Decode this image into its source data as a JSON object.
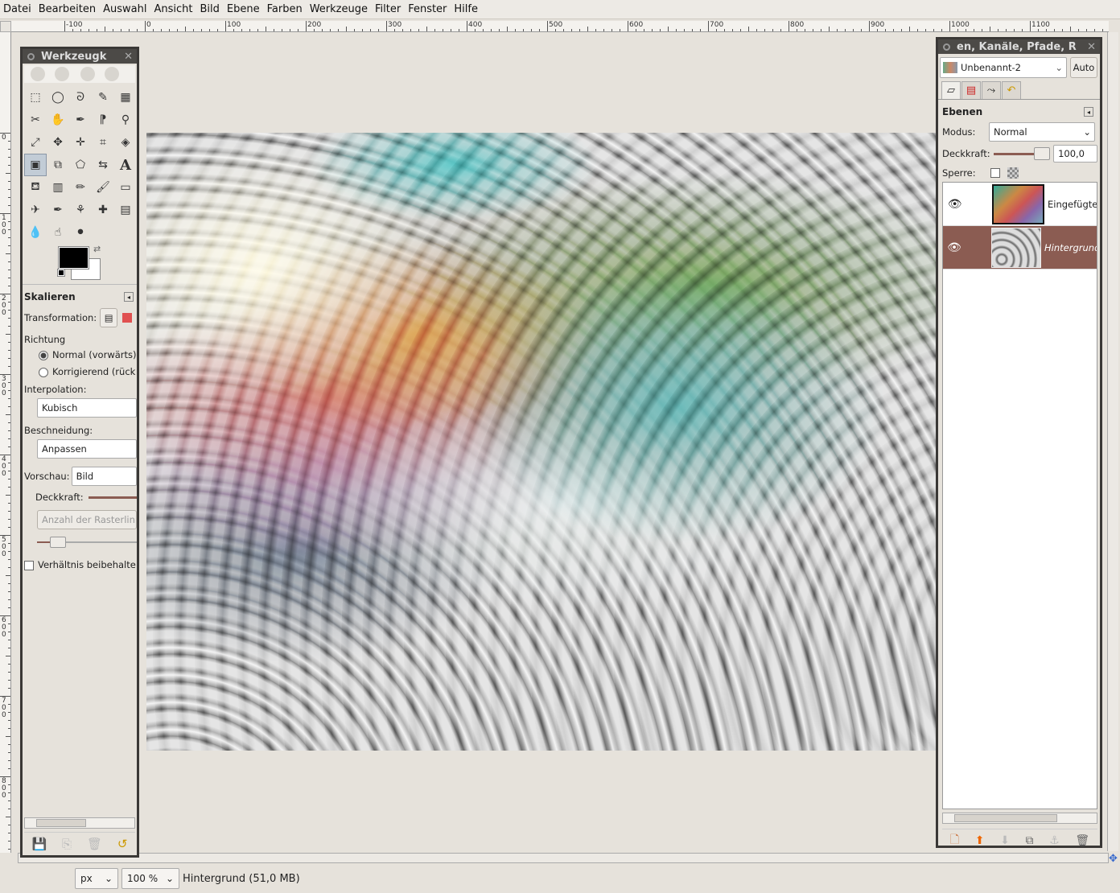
{
  "menu": [
    "Datei",
    "Bearbeiten",
    "Auswahl",
    "Ansicht",
    "Bild",
    "Ebene",
    "Farben",
    "Werkzeuge",
    "Filter",
    "Fenster",
    "Hilfe"
  ],
  "ruler": {
    "h_labels": [
      "-100",
      "0",
      "100",
      "200",
      "300",
      "400",
      "500",
      "600",
      "700",
      "800",
      "900",
      "1000",
      "1100"
    ],
    "v_labels": [
      "0",
      "100",
      "200",
      "300",
      "400",
      "500",
      "600",
      "700",
      "800"
    ]
  },
  "toolbox": {
    "title": "Werkzeugk",
    "tool_icons": [
      "rect-select-icon",
      "ellipse-select-icon",
      "lasso-icon",
      "fuzzy-select-icon",
      "select-by-color-icon",
      "scissors-icon",
      "foreground-select-icon",
      "paths-icon",
      "color-picker-icon",
      "zoom-icon",
      "measure-icon",
      "move-icon",
      "align-icon",
      "crop-icon",
      "rotate-icon",
      "scale-icon",
      "shear-icon",
      "perspective-icon",
      "flip-icon",
      "text-icon",
      "bucket-fill-icon",
      "blend-icon",
      "pencil-icon",
      "paintbrush-icon",
      "eraser-icon",
      "airbrush-icon",
      "ink-icon",
      "clone-icon",
      "heal-icon",
      "perspective-clone-icon",
      "blur-icon",
      "smudge-icon",
      "dodge-burn-icon"
    ],
    "tool_glyphs": [
      "⬚",
      "◯",
      "ᘐ",
      "✎",
      "▦",
      "✂",
      "✋",
      "✒",
      "⁋",
      "⚲",
      "⤢",
      "✥",
      "✛",
      "⌗",
      "◈",
      "▣",
      "⧉",
      "⬠",
      "⇆",
      "A",
      "⛾",
      "▥",
      "✏",
      "🖌",
      "▭",
      "✈",
      "✒",
      "⚘",
      "✚",
      "▤",
      "💧",
      "☝",
      "⚫"
    ],
    "options": {
      "title": "Skalieren",
      "transformation_label": "Transformation:",
      "direction_label": "Richtung",
      "direction_normal": "Normal (vorwärts)",
      "direction_corrective": "Korrigierend (rück",
      "interpolation_label": "Interpolation:",
      "interpolation_value": "Kubisch",
      "clipping_label": "Beschneidung:",
      "clipping_value": "Anpassen",
      "preview_label": "Vorschau:",
      "preview_value": "Bild",
      "opacity_label": "Deckkraft:",
      "gridlines_button": "Anzahl der Rasterlini",
      "keep_aspect_label": "Verhältnis beibehalte"
    }
  },
  "layers_panel": {
    "title": "en, Kanäle, Pfade, R",
    "image_name": "Unbenannt-2",
    "auto_button": "Auto",
    "section_title": "Ebenen",
    "mode_label": "Modus:",
    "mode_value": "Normal",
    "opacity_label": "Deckkraft:",
    "opacity_value": "100,0",
    "lock_label": "Sperre:",
    "layers": [
      {
        "name": "Eingefügte",
        "selected": false
      },
      {
        "name": "Hintergrund",
        "selected": true
      }
    ]
  },
  "status": {
    "unit": "px",
    "zoom": "100 %",
    "info": "Hintergrund (51,0 MB)"
  },
  "colors": {
    "selected_layer": "#8b5c52",
    "panel_title": "#4c4a47",
    "workspace": "#e6e2db"
  }
}
